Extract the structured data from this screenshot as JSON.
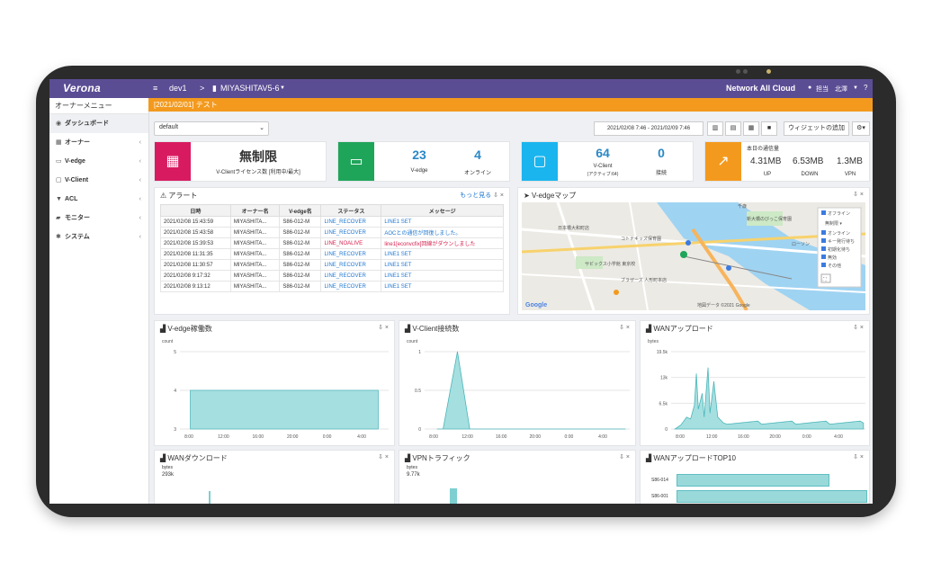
{
  "topbar": {
    "logo": "Verona",
    "menu_icon": "hamburger-icon",
    "breadcrumb_root": "dev1",
    "breadcrumb_sep": ">",
    "breadcrumb_device": "MIYASHITAV5-6",
    "app_name": "Network All Cloud",
    "user1": "担当",
    "user2": "北澤"
  },
  "banner": {
    "text": "[2021/02/01] テスト"
  },
  "sidebar": {
    "title": "オーナーメニュー",
    "items": [
      {
        "label": "ダッシュボード",
        "icon": "dashboard-icon",
        "glyph": "◉",
        "chev": ""
      },
      {
        "label": "オーナー",
        "icon": "building-icon",
        "glyph": "▦",
        "chev": "‹"
      },
      {
        "label": "V-edge",
        "icon": "router-icon",
        "glyph": "▭",
        "chev": "‹"
      },
      {
        "label": "V-Client",
        "icon": "monitor-icon",
        "glyph": "▢",
        "chev": "‹"
      },
      {
        "label": "ACL",
        "icon": "filter-icon",
        "glyph": "▼",
        "chev": "‹"
      },
      {
        "label": "モニター",
        "icon": "chart-icon",
        "glyph": "▰",
        "chev": "‹"
      },
      {
        "label": "システム",
        "icon": "gear-icon",
        "glyph": "✱",
        "chev": "‹"
      }
    ]
  },
  "toolbar": {
    "select_value": "default",
    "date_range": "2021/02/08 7:46 - 2021/02/09 7:46",
    "add_widget": "ウィジェットの追加"
  },
  "stats": {
    "license_value": "無制限",
    "license_label": "V-Clientライセンス数 [利用中/最大]",
    "vedge_count": "23",
    "vedge_label": "V-edge",
    "vedge_online": "4",
    "vedge_online_label": "オンライン",
    "vclient_count": "64",
    "vclient_label": "V-Client",
    "vclient_sub": "(アクティブ:64)",
    "vclient_conn": "0",
    "vclient_conn_label": "接続",
    "traffic_title": "本日の通信量",
    "up_value": "4.31MB",
    "up_label": "UP",
    "down_value": "6.53MB",
    "down_label": "DOWN",
    "vpn_value": "1.3MB",
    "vpn_label": "VPN",
    "colors": {
      "license": "#d81b60",
      "vedge": "#1fa55a",
      "vclient": "#1ab5ee",
      "traffic": "#f39a1e"
    }
  },
  "alert": {
    "title": "アラート",
    "more": "もっと見る",
    "headers": [
      "日時",
      "オーナー名",
      "V-edge名",
      "ステータス",
      "メッセージ"
    ],
    "rows": [
      [
        "2021/02/08 15:43:59",
        "MIYASHITA...",
        "S86-012-M",
        "LINE_RECOVER",
        "LINE1 SET"
      ],
      [
        "2021/02/08 15:43:58",
        "MIYASHITA...",
        "S86-012-M",
        "LINE_RECOVER",
        "AOCとの通信が回復しました。"
      ],
      [
        "2021/02/08 15:39:53",
        "MIYASHITA...",
        "S86-012-M",
        "LINE_NOALIVE",
        "line1[econvcfix]回線がダウンしました"
      ],
      [
        "2021/02/08 11:31:35",
        "MIYASHITA...",
        "S86-012-M",
        "LINE_RECOVER",
        "LINE1 SET"
      ],
      [
        "2021/02/08 11:30:57",
        "MIYASHITA...",
        "S86-012-M",
        "LINE_RECOVER",
        "LINE1 SET"
      ],
      [
        "2021/02/08 9:17:32",
        "MIYASHITA...",
        "S86-012-M",
        "LINE_RECOVER",
        "LINE1 SET"
      ],
      [
        "2021/02/08 9:13:12",
        "MIYASHITA...",
        "S86-012-M",
        "LINE_RECOVER",
        "LINE1 SET"
      ]
    ]
  },
  "map": {
    "title": "V-edgeマップ",
    "legend": [
      "オフライン",
      "オンライン",
      "キー発行待ち",
      "初期化待ち",
      "無効",
      "その他"
    ],
    "legend_select": "無制限",
    "labels": [
      "日本橋大和町店",
      "コトナキッズ保育園",
      "サビックス小学館 東京校",
      "ブラザーズ 人形町本店",
      "ローソン",
      "新大橋のびっこ保育園",
      "千歳"
    ],
    "footer": "地図データ ©2021 Google",
    "google": "Google"
  },
  "charts": {
    "c1": {
      "title": "V-edge稼働数",
      "ylabel": "count",
      "yticks": [
        "5",
        "4",
        "3"
      ],
      "xticks": [
        "8:00",
        "12:00",
        "16:00",
        "20:00",
        "0:00",
        "4:00"
      ]
    },
    "c2": {
      "title": "V-Client接続数",
      "ylabel": "count",
      "yticks": [
        "1",
        "0.5",
        "0"
      ],
      "xticks": [
        "8:00",
        "12:00",
        "16:00",
        "20:00",
        "0:00",
        "4:00"
      ]
    },
    "c3": {
      "title": "WANアップロード",
      "ylabel": "bytes",
      "yticks": [
        "19.5k",
        "13k",
        "6.5k",
        "0"
      ],
      "xticks": [
        "8:00",
        "12:00",
        "16:00",
        "20:00",
        "0:00",
        "4:00"
      ]
    },
    "c4": {
      "title": "WANダウンロード",
      "ylabel": "bytes",
      "yticks": [
        "293k"
      ]
    },
    "c5": {
      "title": "VPNトラフィック",
      "ylabel": "bytes",
      "yticks": [
        "9.77k"
      ]
    },
    "c6": {
      "title": "WANアップロードTOP10",
      "yticks": [
        "S86-014",
        "S86-001"
      ]
    }
  }
}
